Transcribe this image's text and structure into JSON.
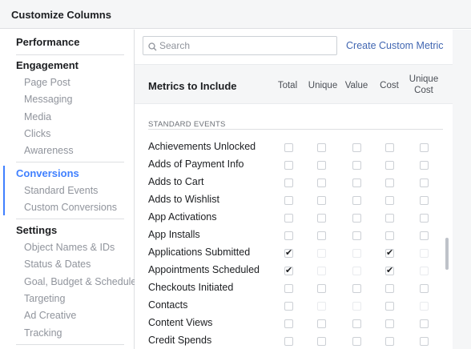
{
  "window": {
    "title": "Customize Columns"
  },
  "sidebar": {
    "performance": "Performance",
    "engagement": {
      "title": "Engagement",
      "items": [
        "Page Post",
        "Messaging",
        "Media",
        "Clicks",
        "Awareness"
      ]
    },
    "conversions": {
      "title": "Conversions",
      "items": [
        "Standard Events",
        "Custom Conversions"
      ]
    },
    "settings": {
      "title": "Settings",
      "items": [
        "Object Names & IDs",
        "Status & Dates",
        "Goal, Budget & Schedule",
        "Targeting",
        "Ad Creative",
        "Tracking"
      ]
    }
  },
  "search": {
    "placeholder": "Search"
  },
  "create_link": "Create Custom Metric",
  "metrics": {
    "title": "Metrics to Include",
    "columns": [
      "Total",
      "Unique",
      "Value",
      "Cost",
      "Unique Cost"
    ],
    "group_label": "STANDARD EVENTS",
    "rows": [
      {
        "label": "Achievements Unlocked",
        "checks": [
          false,
          false,
          false,
          false,
          false
        ],
        "enabled": [
          true,
          true,
          true,
          true,
          true
        ]
      },
      {
        "label": "Adds of Payment Info",
        "checks": [
          false,
          false,
          false,
          false,
          false
        ],
        "enabled": [
          true,
          true,
          true,
          true,
          true
        ]
      },
      {
        "label": "Adds to Cart",
        "checks": [
          false,
          false,
          false,
          false,
          false
        ],
        "enabled": [
          true,
          true,
          true,
          true,
          true
        ]
      },
      {
        "label": "Adds to Wishlist",
        "checks": [
          false,
          false,
          false,
          false,
          false
        ],
        "enabled": [
          true,
          true,
          true,
          true,
          true
        ]
      },
      {
        "label": "App Activations",
        "checks": [
          false,
          false,
          false,
          false,
          false
        ],
        "enabled": [
          true,
          true,
          true,
          true,
          true
        ]
      },
      {
        "label": "App Installs",
        "checks": [
          false,
          false,
          false,
          false,
          false
        ],
        "enabled": [
          true,
          true,
          true,
          true,
          true
        ]
      },
      {
        "label": "Applications Submitted",
        "checks": [
          true,
          false,
          false,
          true,
          false
        ],
        "enabled": [
          true,
          false,
          false,
          true,
          false
        ]
      },
      {
        "label": "Appointments Scheduled",
        "checks": [
          true,
          false,
          false,
          true,
          false
        ],
        "enabled": [
          true,
          false,
          false,
          true,
          false
        ]
      },
      {
        "label": "Checkouts Initiated",
        "checks": [
          false,
          false,
          false,
          false,
          false
        ],
        "enabled": [
          true,
          true,
          true,
          true,
          true
        ]
      },
      {
        "label": "Contacts",
        "checks": [
          false,
          false,
          false,
          false,
          false
        ],
        "enabled": [
          true,
          false,
          false,
          true,
          false
        ]
      },
      {
        "label": "Content Views",
        "checks": [
          false,
          false,
          false,
          false,
          false
        ],
        "enabled": [
          true,
          true,
          true,
          true,
          true
        ]
      },
      {
        "label": "Credit Spends",
        "checks": [
          false,
          false,
          false,
          false,
          false
        ],
        "enabled": [
          true,
          true,
          true,
          true,
          true
        ]
      }
    ]
  },
  "icons": {
    "search": "search-icon",
    "check": "check-icon"
  },
  "colors": {
    "accent": "#4080ff",
    "link": "#4267b2"
  }
}
